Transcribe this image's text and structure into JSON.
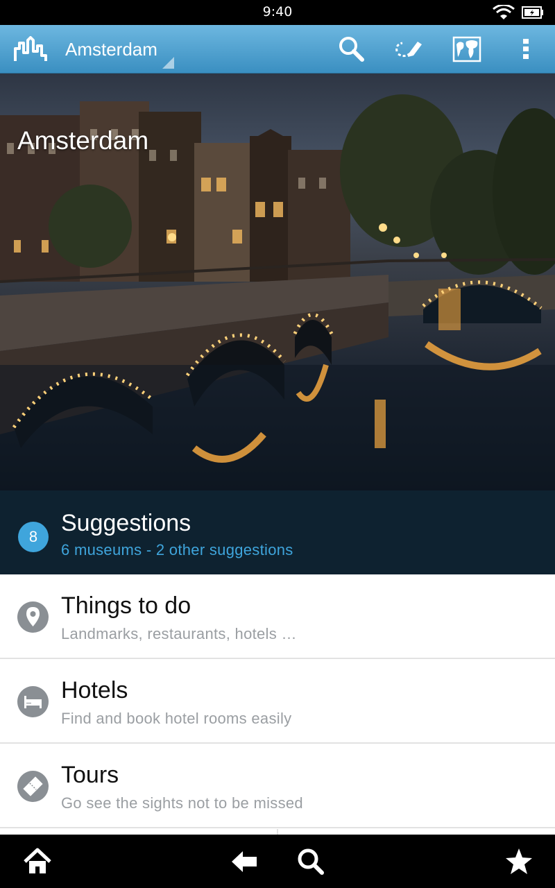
{
  "status_bar": {
    "time": "9:40"
  },
  "action_bar": {
    "city": "Amsterdam"
  },
  "hero": {
    "title": "Amsterdam"
  },
  "suggestions": {
    "count": "8",
    "title": "Suggestions",
    "subtitle": "6 museums - 2 other suggestions"
  },
  "list": [
    {
      "icon": "map-pin-icon",
      "title": "Things to do",
      "subtitle": "Landmarks, restaurants, hotels …"
    },
    {
      "icon": "bed-icon",
      "title": "Hotels",
      "subtitle": "Find and book hotel rooms easily"
    },
    {
      "icon": "ticket-icon",
      "title": "Tours",
      "subtitle": "Go see the sights not to be missed"
    }
  ],
  "colors": {
    "action_bar": "#3a8fc1",
    "suggestions_bg": "#0e2230",
    "accent": "#3fa5dc",
    "icon_circle": "#8a8f94"
  }
}
